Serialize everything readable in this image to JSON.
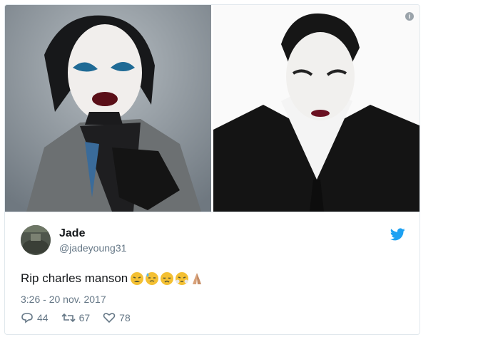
{
  "tweet": {
    "display_name": "Jade",
    "handle": "@jadeyoung31",
    "text": "Rip charles manson",
    "emojis": [
      "weary-face",
      "sweat-face",
      "disappointed-face",
      "steam-face",
      "folded-hands"
    ],
    "timestamp": "3:26 - 20 nov. 2017",
    "reply_count": "44",
    "retweet_count": "67",
    "like_count": "78"
  },
  "media": {
    "info_icon": "i"
  },
  "colors": {
    "brand": "#1da1f2",
    "secondary_text": "#657786",
    "primary_text": "#14171a",
    "border": "#e1e8ed"
  },
  "icons": {
    "brand": "twitter-bird-icon",
    "reply": "reply-icon",
    "retweet": "retweet-icon",
    "like": "heart-icon",
    "info": "info-icon"
  }
}
